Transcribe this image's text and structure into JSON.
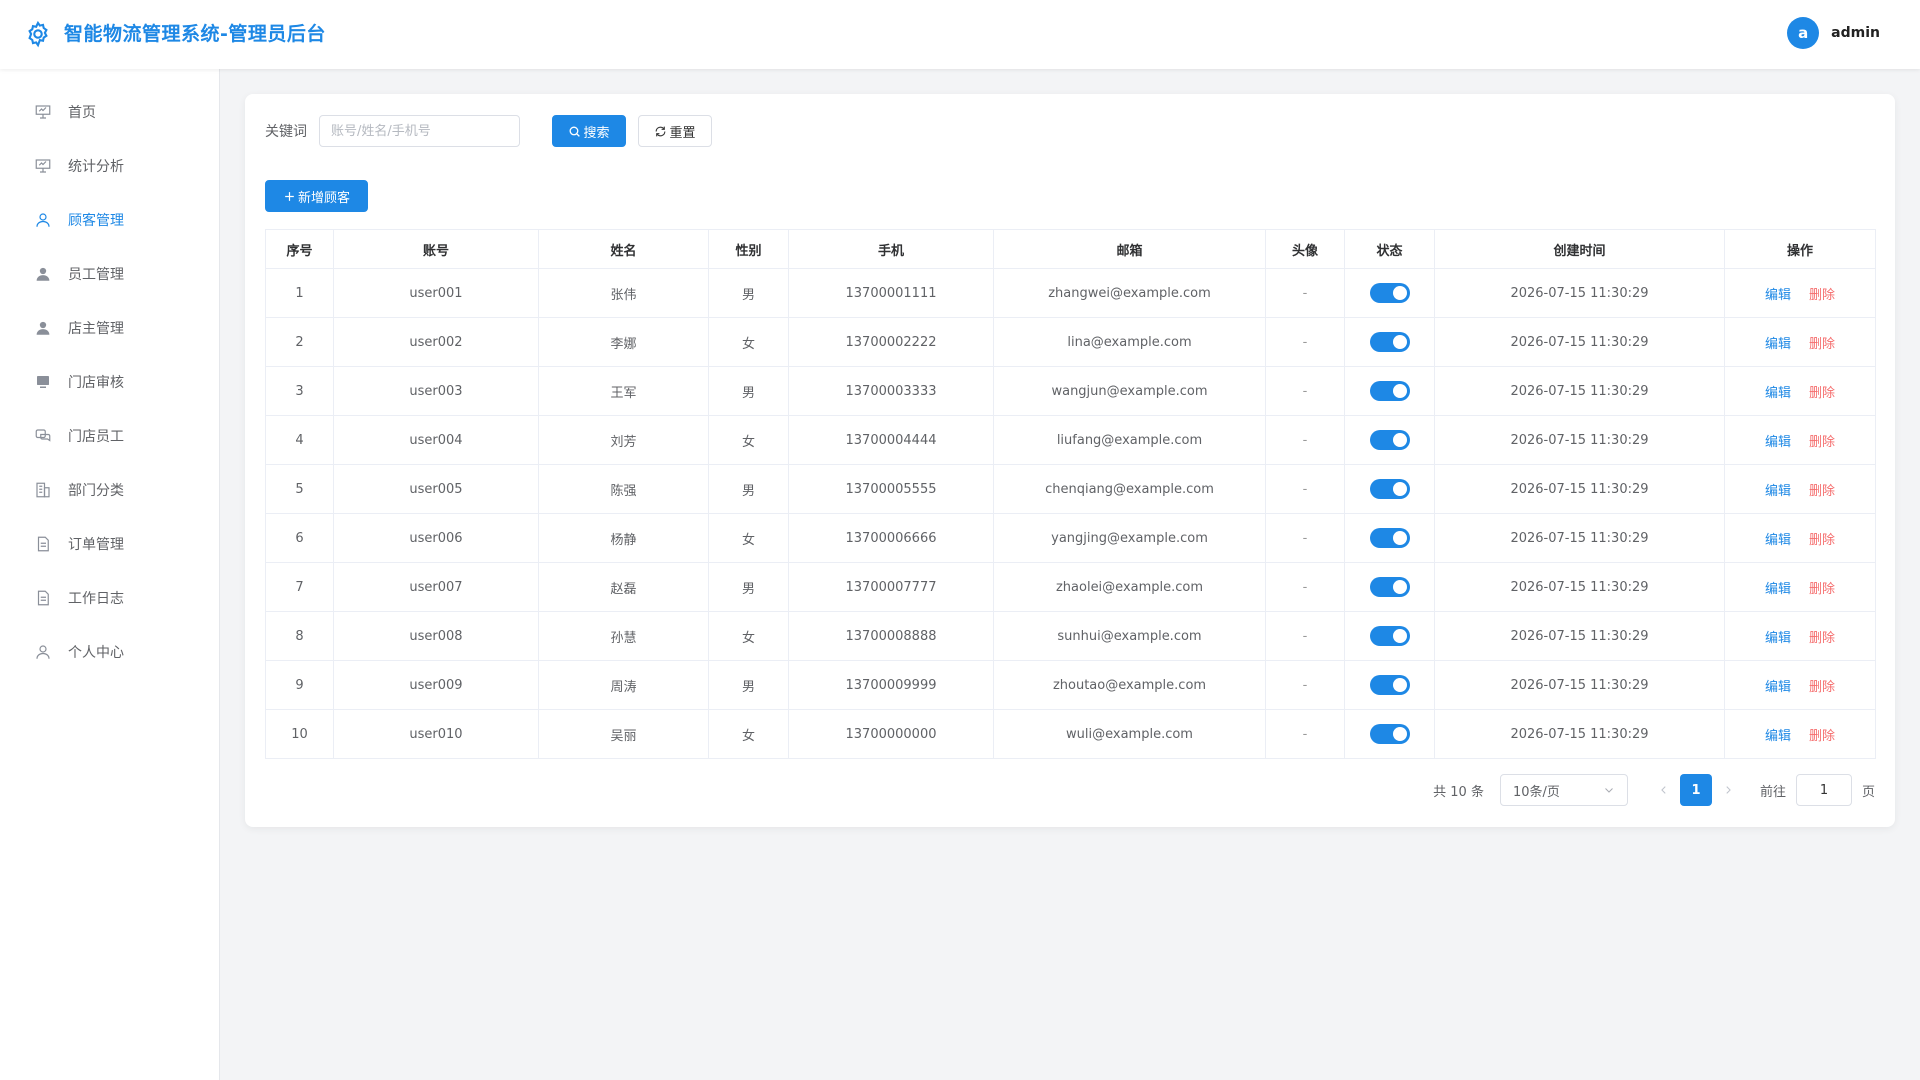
{
  "app": {
    "title": "智能物流管理系统-管理员后台",
    "logo_icon": "gear-icon",
    "user_avatar_letter": "a",
    "user_name": "admin",
    "accent_color": "#1e88e5",
    "danger_color": "#f56c6c"
  },
  "sidebar": {
    "items": [
      {
        "label": "首页",
        "icon": "presentation-icon",
        "active": false
      },
      {
        "label": "统计分析",
        "icon": "presentation-icon",
        "active": false
      },
      {
        "label": "顾客管理",
        "icon": "user-outline-icon",
        "active": true
      },
      {
        "label": "员工管理",
        "icon": "user-filled-icon",
        "active": false
      },
      {
        "label": "店主管理",
        "icon": "user-filled-icon",
        "active": false
      },
      {
        "label": "门店审核",
        "icon": "monitor-icon",
        "active": false
      },
      {
        "label": "门店员工",
        "icon": "chat-icon",
        "active": false
      },
      {
        "label": "部门分类",
        "icon": "building-icon",
        "active": false
      },
      {
        "label": "订单管理",
        "icon": "document-icon",
        "active": false
      },
      {
        "label": "工作日志",
        "icon": "document-icon",
        "active": false
      },
      {
        "label": "个人中心",
        "icon": "user-outline-icon",
        "active": false
      }
    ]
  },
  "search": {
    "label": "关键词",
    "placeholder": "账号/姓名/手机号",
    "value": "",
    "search_button": "搜索",
    "reset_button": "重置"
  },
  "toolbar": {
    "add_button": "新增顾客"
  },
  "table": {
    "columns": [
      "序号",
      "账号",
      "姓名",
      "性别",
      "手机",
      "邮箱",
      "头像",
      "状态",
      "创建时间",
      "操作"
    ],
    "rows": [
      {
        "index": "1",
        "account": "user001",
        "name": "张伟",
        "gender": "男",
        "phone": "13700001111",
        "email": "zhangwei@example.com",
        "avatar": "-",
        "status": true,
        "created": "2026-07-15 11:30:29"
      },
      {
        "index": "2",
        "account": "user002",
        "name": "李娜",
        "gender": "女",
        "phone": "13700002222",
        "email": "lina@example.com",
        "avatar": "-",
        "status": true,
        "created": "2026-07-15 11:30:29"
      },
      {
        "index": "3",
        "account": "user003",
        "name": "王军",
        "gender": "男",
        "phone": "13700003333",
        "email": "wangjun@example.com",
        "avatar": "-",
        "status": true,
        "created": "2026-07-15 11:30:29"
      },
      {
        "index": "4",
        "account": "user004",
        "name": "刘芳",
        "gender": "女",
        "phone": "13700004444",
        "email": "liufang@example.com",
        "avatar": "-",
        "status": true,
        "created": "2026-07-15 11:30:29"
      },
      {
        "index": "5",
        "account": "user005",
        "name": "陈强",
        "gender": "男",
        "phone": "13700005555",
        "email": "chenqiang@example.com",
        "avatar": "-",
        "status": true,
        "created": "2026-07-15 11:30:29"
      },
      {
        "index": "6",
        "account": "user006",
        "name": "杨静",
        "gender": "女",
        "phone": "13700006666",
        "email": "yangjing@example.com",
        "avatar": "-",
        "status": true,
        "created": "2026-07-15 11:30:29"
      },
      {
        "index": "7",
        "account": "user007",
        "name": "赵磊",
        "gender": "男",
        "phone": "13700007777",
        "email": "zhaolei@example.com",
        "avatar": "-",
        "status": true,
        "created": "2026-07-15 11:30:29"
      },
      {
        "index": "8",
        "account": "user008",
        "name": "孙慧",
        "gender": "女",
        "phone": "13700008888",
        "email": "sunhui@example.com",
        "avatar": "-",
        "status": true,
        "created": "2026-07-15 11:30:29"
      },
      {
        "index": "9",
        "account": "user009",
        "name": "周涛",
        "gender": "男",
        "phone": "13700009999",
        "email": "zhoutao@example.com",
        "avatar": "-",
        "status": true,
        "created": "2026-07-15 11:30:29"
      },
      {
        "index": "10",
        "account": "user010",
        "name": "吴丽",
        "gender": "女",
        "phone": "13700000000",
        "email": "wuli@example.com",
        "avatar": "-",
        "status": true,
        "created": "2026-07-15 11:30:29"
      }
    ],
    "edit_label": "编辑",
    "delete_label": "删除"
  },
  "pagination": {
    "total_text": "共 10 条",
    "page_size": "10条/页",
    "current_page": "1",
    "goto_label": "前往",
    "goto_value": "1",
    "page_suffix": "页"
  }
}
